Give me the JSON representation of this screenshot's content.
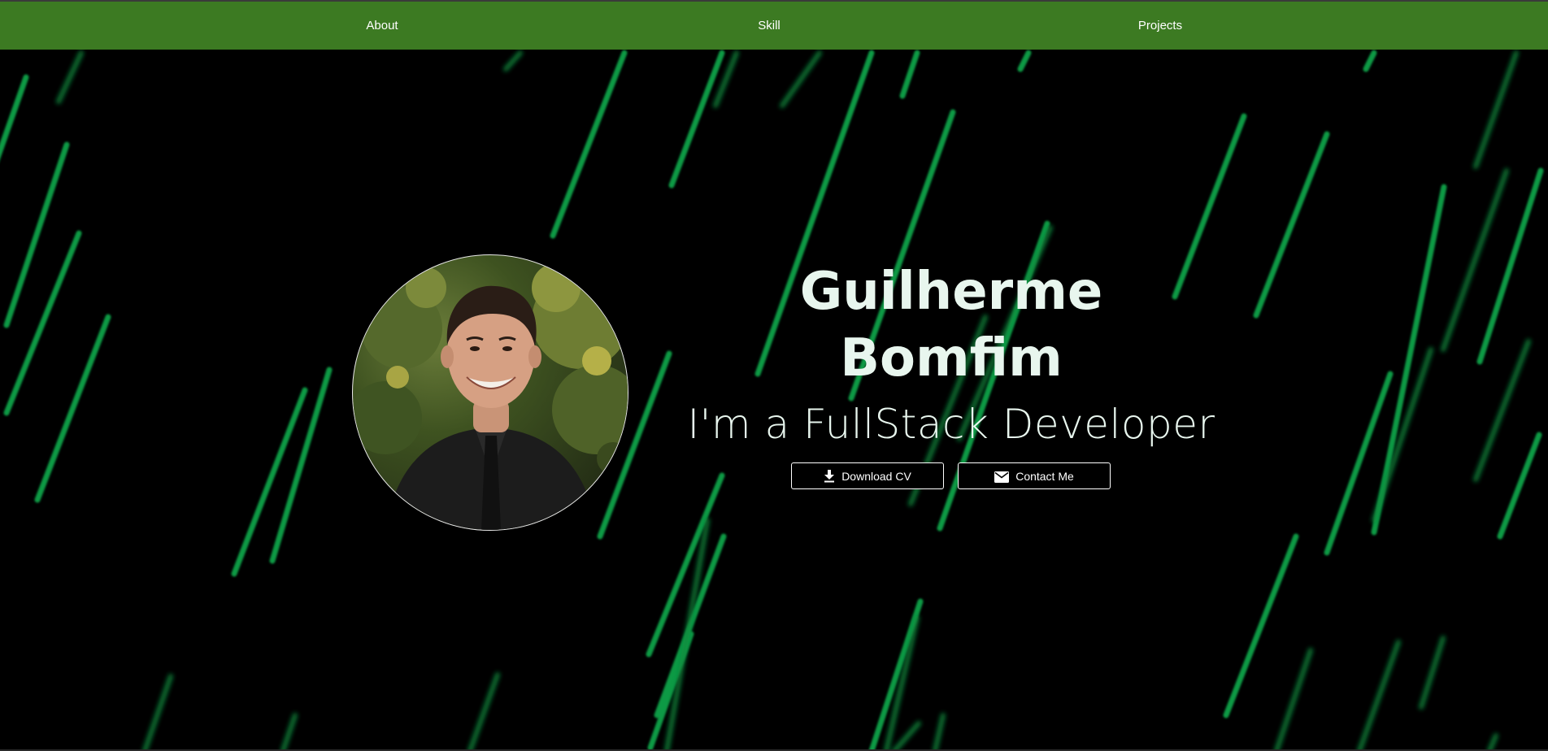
{
  "nav": {
    "items": [
      {
        "label": "About"
      },
      {
        "label": "Skill"
      },
      {
        "label": "Projects"
      }
    ],
    "background": "#3c7a22"
  },
  "hero": {
    "name_first": "Guilherme",
    "name_last": "Bomfim",
    "role": "I'm a FullStack Developer",
    "avatar_alt": "profile photo",
    "buttons": {
      "download_label": "Download CV",
      "download_icon": "download-icon",
      "contact_label": "Contact Me",
      "contact_icon": "mail-icon"
    }
  },
  "theme": {
    "background": "#000000",
    "accent": "#0f9d49",
    "text": "#e8f6ee"
  }
}
